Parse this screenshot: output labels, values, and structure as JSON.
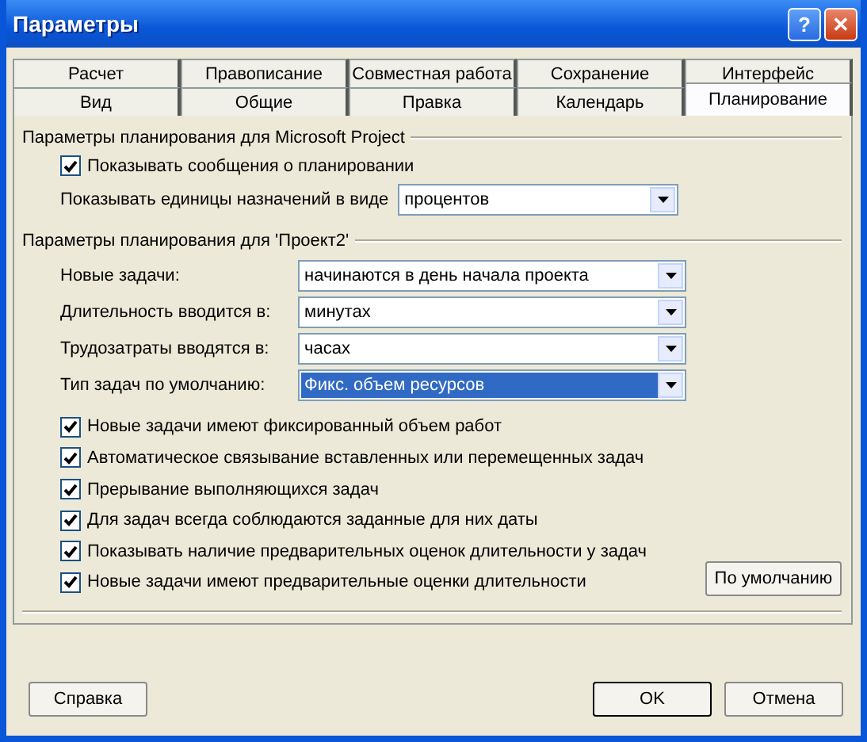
{
  "window": {
    "title": "Параметры",
    "help_button": "?",
    "close_button": "✕"
  },
  "tab_rows": [
    [
      {
        "label": "Расчет",
        "selected": false
      },
      {
        "label": "Правописание",
        "selected": false
      },
      {
        "label": "Совместная работа",
        "selected": false
      },
      {
        "label": "Сохранение",
        "selected": false
      },
      {
        "label": "Интерфейс",
        "selected": false
      }
    ],
    [
      {
        "label": "Вид",
        "selected": false
      },
      {
        "label": "Общие",
        "selected": false
      },
      {
        "label": "Правка",
        "selected": false
      },
      {
        "label": "Календарь",
        "selected": false
      },
      {
        "label": "Планирование",
        "selected": true
      }
    ]
  ],
  "section_app": {
    "title": "Параметры планирования для Microsoft Project",
    "checkbox": {
      "label": "Показывать сообщения о планировании",
      "checked": true
    },
    "units": {
      "label": "Показывать единицы назначений в виде",
      "value": "процентов"
    }
  },
  "section_project": {
    "title": "Параметры планирования для 'Проект2'",
    "dropdowns": [
      {
        "label": "Новые задачи:",
        "value": "начинаются в день начала проекта",
        "focused": false
      },
      {
        "label": "Длительность вводится в:",
        "value": "минутах",
        "focused": false
      },
      {
        "label": "Трудозатраты вводятся в:",
        "value": "часах",
        "focused": false
      },
      {
        "label": "Тип задач по умолчанию:",
        "value": "Фикс. объем ресурсов",
        "focused": true
      }
    ],
    "checkboxes": [
      {
        "label": "Новые задачи имеют фиксированный объем работ",
        "checked": true
      },
      {
        "label": "Автоматическое связывание вставленных или перемещенных задач",
        "checked": true
      },
      {
        "label": "Прерывание выполняющихся задач",
        "checked": true
      },
      {
        "label": "Для задач всегда соблюдаются заданные для них даты",
        "checked": true
      },
      {
        "label": "Показывать наличие предварительных оценок длительности у задач",
        "checked": true
      },
      {
        "label": "Новые задачи имеют предварительные оценки длительности",
        "checked": true
      }
    ],
    "default_button": "По умолчанию"
  },
  "buttons": {
    "help": "Справка",
    "ok": "OK",
    "cancel": "Отмена"
  }
}
